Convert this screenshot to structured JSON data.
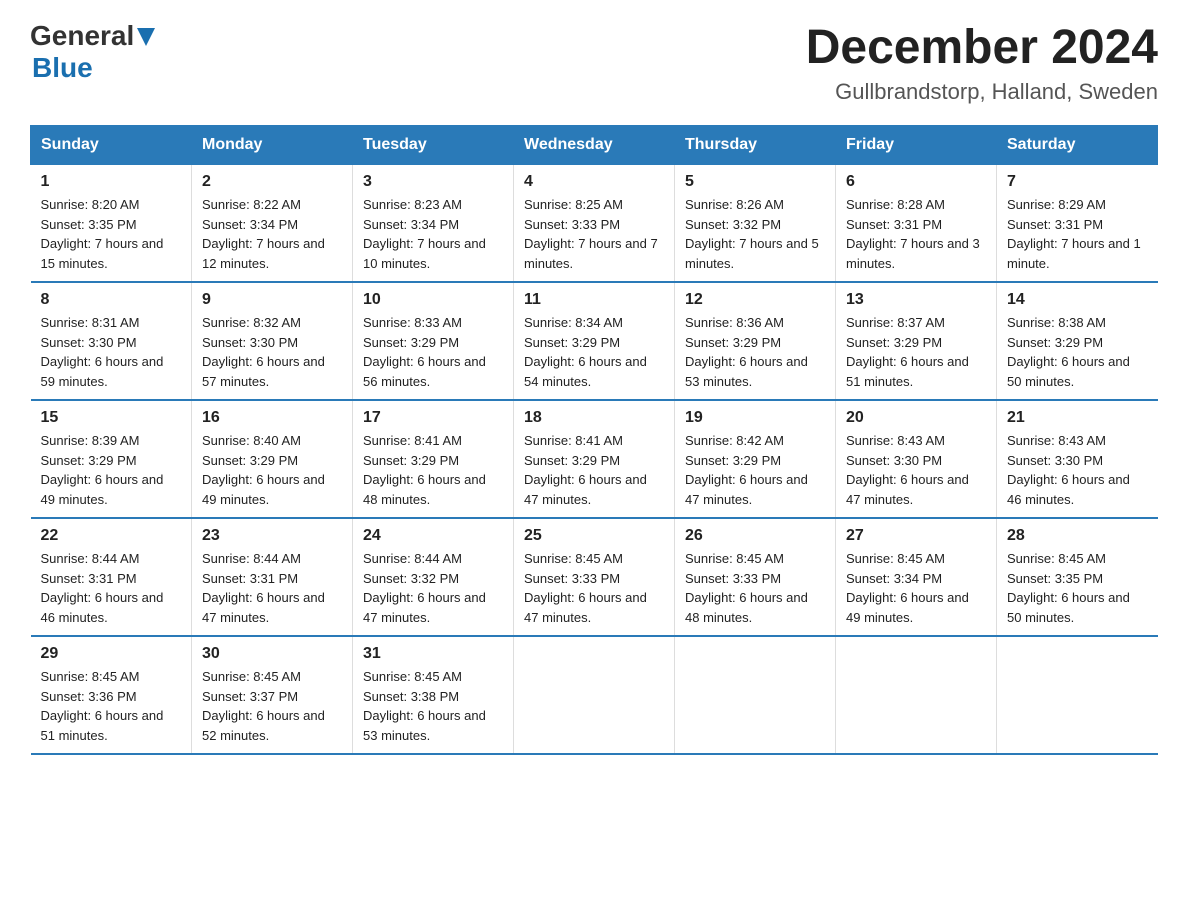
{
  "header": {
    "logo": {
      "general": "General",
      "blue": "Blue"
    },
    "title": "December 2024",
    "location": "Gullbrandstorp, Halland, Sweden"
  },
  "days_of_week": [
    "Sunday",
    "Monday",
    "Tuesday",
    "Wednesday",
    "Thursday",
    "Friday",
    "Saturday"
  ],
  "weeks": [
    [
      {
        "day": "1",
        "sunrise": "Sunrise: 8:20 AM",
        "sunset": "Sunset: 3:35 PM",
        "daylight": "Daylight: 7 hours and 15 minutes."
      },
      {
        "day": "2",
        "sunrise": "Sunrise: 8:22 AM",
        "sunset": "Sunset: 3:34 PM",
        "daylight": "Daylight: 7 hours and 12 minutes."
      },
      {
        "day": "3",
        "sunrise": "Sunrise: 8:23 AM",
        "sunset": "Sunset: 3:34 PM",
        "daylight": "Daylight: 7 hours and 10 minutes."
      },
      {
        "day": "4",
        "sunrise": "Sunrise: 8:25 AM",
        "sunset": "Sunset: 3:33 PM",
        "daylight": "Daylight: 7 hours and 7 minutes."
      },
      {
        "day": "5",
        "sunrise": "Sunrise: 8:26 AM",
        "sunset": "Sunset: 3:32 PM",
        "daylight": "Daylight: 7 hours and 5 minutes."
      },
      {
        "day": "6",
        "sunrise": "Sunrise: 8:28 AM",
        "sunset": "Sunset: 3:31 PM",
        "daylight": "Daylight: 7 hours and 3 minutes."
      },
      {
        "day": "7",
        "sunrise": "Sunrise: 8:29 AM",
        "sunset": "Sunset: 3:31 PM",
        "daylight": "Daylight: 7 hours and 1 minute."
      }
    ],
    [
      {
        "day": "8",
        "sunrise": "Sunrise: 8:31 AM",
        "sunset": "Sunset: 3:30 PM",
        "daylight": "Daylight: 6 hours and 59 minutes."
      },
      {
        "day": "9",
        "sunrise": "Sunrise: 8:32 AM",
        "sunset": "Sunset: 3:30 PM",
        "daylight": "Daylight: 6 hours and 57 minutes."
      },
      {
        "day": "10",
        "sunrise": "Sunrise: 8:33 AM",
        "sunset": "Sunset: 3:29 PM",
        "daylight": "Daylight: 6 hours and 56 minutes."
      },
      {
        "day": "11",
        "sunrise": "Sunrise: 8:34 AM",
        "sunset": "Sunset: 3:29 PM",
        "daylight": "Daylight: 6 hours and 54 minutes."
      },
      {
        "day": "12",
        "sunrise": "Sunrise: 8:36 AM",
        "sunset": "Sunset: 3:29 PM",
        "daylight": "Daylight: 6 hours and 53 minutes."
      },
      {
        "day": "13",
        "sunrise": "Sunrise: 8:37 AM",
        "sunset": "Sunset: 3:29 PM",
        "daylight": "Daylight: 6 hours and 51 minutes."
      },
      {
        "day": "14",
        "sunrise": "Sunrise: 8:38 AM",
        "sunset": "Sunset: 3:29 PM",
        "daylight": "Daylight: 6 hours and 50 minutes."
      }
    ],
    [
      {
        "day": "15",
        "sunrise": "Sunrise: 8:39 AM",
        "sunset": "Sunset: 3:29 PM",
        "daylight": "Daylight: 6 hours and 49 minutes."
      },
      {
        "day": "16",
        "sunrise": "Sunrise: 8:40 AM",
        "sunset": "Sunset: 3:29 PM",
        "daylight": "Daylight: 6 hours and 49 minutes."
      },
      {
        "day": "17",
        "sunrise": "Sunrise: 8:41 AM",
        "sunset": "Sunset: 3:29 PM",
        "daylight": "Daylight: 6 hours and 48 minutes."
      },
      {
        "day": "18",
        "sunrise": "Sunrise: 8:41 AM",
        "sunset": "Sunset: 3:29 PM",
        "daylight": "Daylight: 6 hours and 47 minutes."
      },
      {
        "day": "19",
        "sunrise": "Sunrise: 8:42 AM",
        "sunset": "Sunset: 3:29 PM",
        "daylight": "Daylight: 6 hours and 47 minutes."
      },
      {
        "day": "20",
        "sunrise": "Sunrise: 8:43 AM",
        "sunset": "Sunset: 3:30 PM",
        "daylight": "Daylight: 6 hours and 47 minutes."
      },
      {
        "day": "21",
        "sunrise": "Sunrise: 8:43 AM",
        "sunset": "Sunset: 3:30 PM",
        "daylight": "Daylight: 6 hours and 46 minutes."
      }
    ],
    [
      {
        "day": "22",
        "sunrise": "Sunrise: 8:44 AM",
        "sunset": "Sunset: 3:31 PM",
        "daylight": "Daylight: 6 hours and 46 minutes."
      },
      {
        "day": "23",
        "sunrise": "Sunrise: 8:44 AM",
        "sunset": "Sunset: 3:31 PM",
        "daylight": "Daylight: 6 hours and 47 minutes."
      },
      {
        "day": "24",
        "sunrise": "Sunrise: 8:44 AM",
        "sunset": "Sunset: 3:32 PM",
        "daylight": "Daylight: 6 hours and 47 minutes."
      },
      {
        "day": "25",
        "sunrise": "Sunrise: 8:45 AM",
        "sunset": "Sunset: 3:33 PM",
        "daylight": "Daylight: 6 hours and 47 minutes."
      },
      {
        "day": "26",
        "sunrise": "Sunrise: 8:45 AM",
        "sunset": "Sunset: 3:33 PM",
        "daylight": "Daylight: 6 hours and 48 minutes."
      },
      {
        "day": "27",
        "sunrise": "Sunrise: 8:45 AM",
        "sunset": "Sunset: 3:34 PM",
        "daylight": "Daylight: 6 hours and 49 minutes."
      },
      {
        "day": "28",
        "sunrise": "Sunrise: 8:45 AM",
        "sunset": "Sunset: 3:35 PM",
        "daylight": "Daylight: 6 hours and 50 minutes."
      }
    ],
    [
      {
        "day": "29",
        "sunrise": "Sunrise: 8:45 AM",
        "sunset": "Sunset: 3:36 PM",
        "daylight": "Daylight: 6 hours and 51 minutes."
      },
      {
        "day": "30",
        "sunrise": "Sunrise: 8:45 AM",
        "sunset": "Sunset: 3:37 PM",
        "daylight": "Daylight: 6 hours and 52 minutes."
      },
      {
        "day": "31",
        "sunrise": "Sunrise: 8:45 AM",
        "sunset": "Sunset: 3:38 PM",
        "daylight": "Daylight: 6 hours and 53 minutes."
      },
      null,
      null,
      null,
      null
    ]
  ]
}
